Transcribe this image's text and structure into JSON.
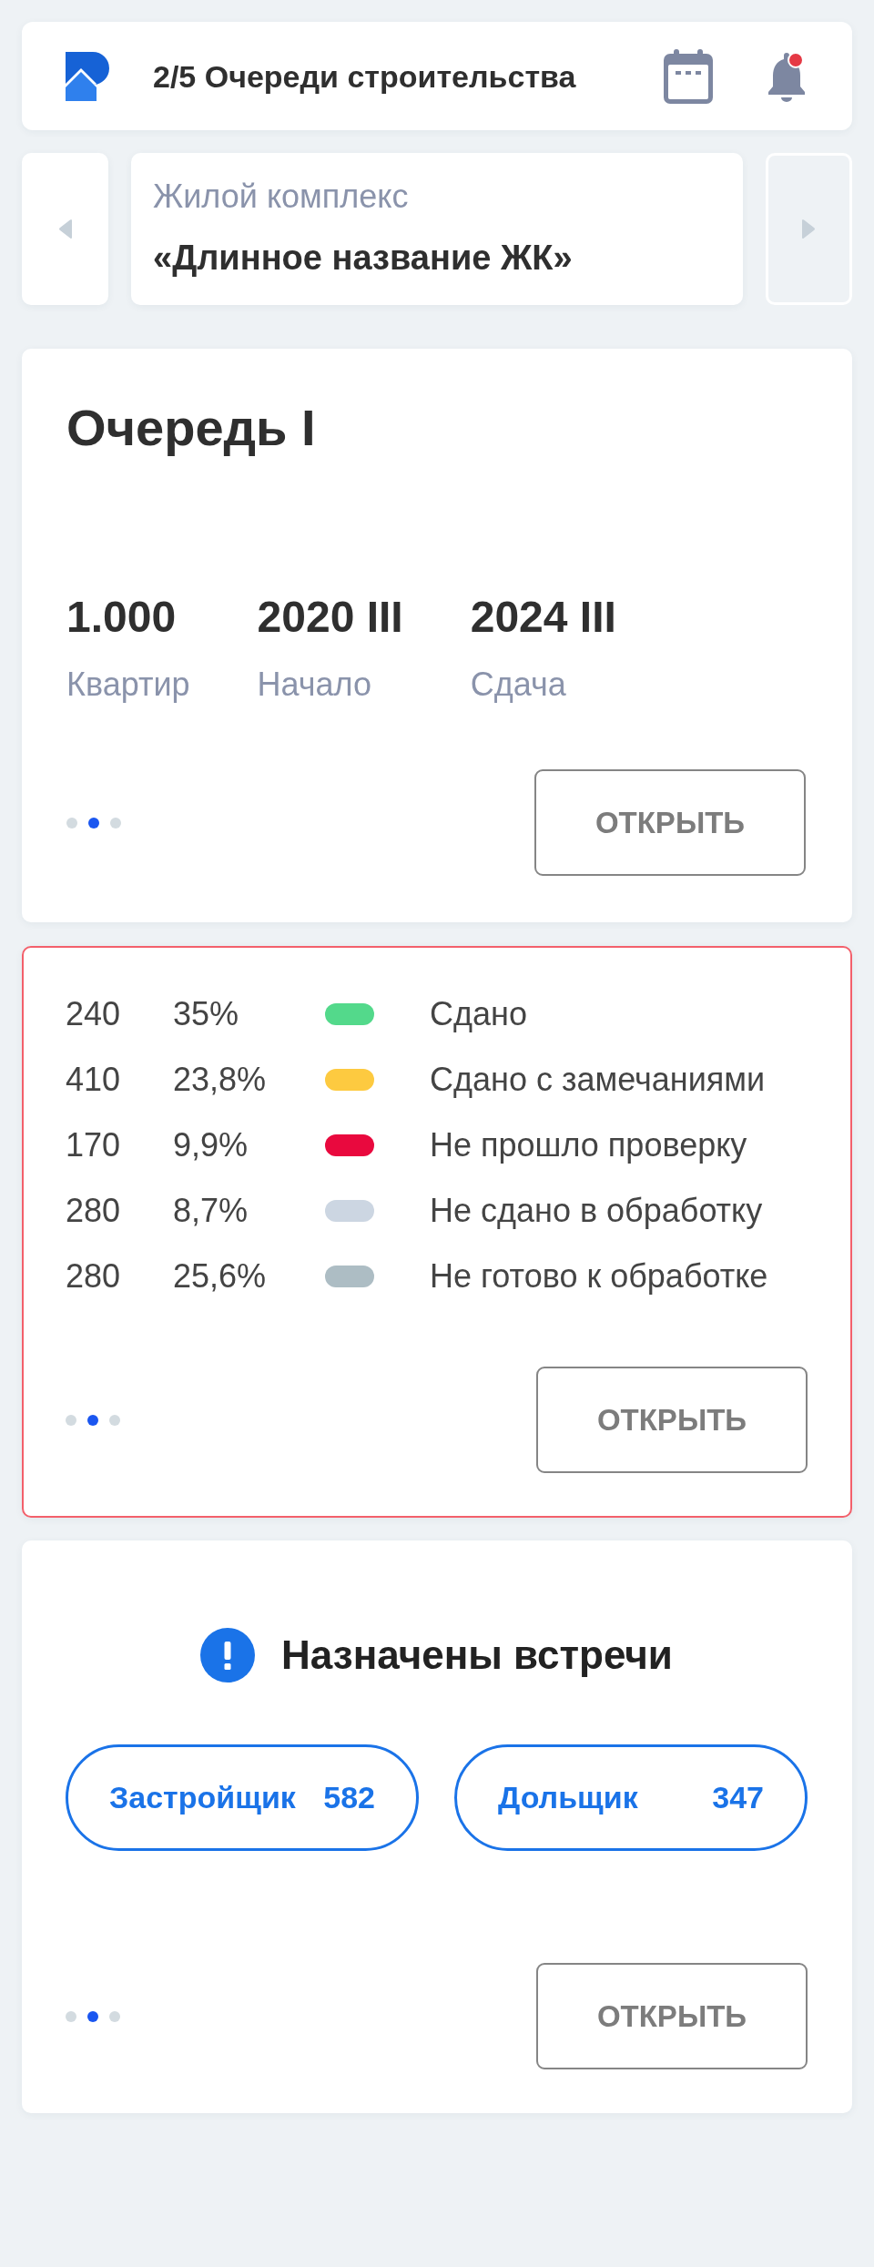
{
  "header": {
    "title": "2/5 Очереди строительства",
    "has_unread": true
  },
  "switcher": {
    "prev": {
      "disabled": false
    },
    "next": {
      "disabled": true
    },
    "label": "Жилой комплекс",
    "name": "«Длинное название ЖК»"
  },
  "cards": [
    {
      "kind": "stage",
      "highlighted": false,
      "title": "Очередь I",
      "stats": [
        {
          "value": "1.000",
          "label": "Квартир"
        },
        {
          "value": "2020 III",
          "label": "Начало"
        },
        {
          "value": "2024 III",
          "label": "Сдача"
        }
      ],
      "pager": [
        {
          "selected": false
        },
        {
          "selected": true
        },
        {
          "selected": false
        }
      ],
      "button": "ОТКРЫТЬ"
    },
    {
      "kind": "statuses",
      "highlighted": true,
      "rows": [
        {
          "count": "240",
          "percent": "35%",
          "color": "#53d98b",
          "label": "Сдано"
        },
        {
          "count": "410",
          "percent": "23,8%",
          "color": "#fdca40",
          "label": "Сдано с замечаниями"
        },
        {
          "count": "170",
          "percent": "9,9%",
          "color": "#e9093e",
          "label": "Не прошло проверку"
        },
        {
          "count": "280",
          "percent": "8,7%",
          "color": "#ccd6e2",
          "label": "Не сдано в обработку"
        },
        {
          "count": "280",
          "percent": "25,6%",
          "color": "#adbdc4",
          "label": "Не готово к обработке"
        }
      ],
      "pager": [
        {
          "selected": false
        },
        {
          "selected": true
        },
        {
          "selected": false
        }
      ],
      "button": "ОТКРЫТЬ"
    },
    {
      "kind": "meetings",
      "highlighted": false,
      "title": "Назначены встречи",
      "chips": [
        {
          "label": "Застройщик",
          "count": "582"
        },
        {
          "label": "Дольщик",
          "count": "347"
        }
      ],
      "pager": [
        {
          "selected": false
        },
        {
          "selected": true
        },
        {
          "selected": false
        }
      ],
      "button": "ОТКРЫТЬ"
    }
  ]
}
